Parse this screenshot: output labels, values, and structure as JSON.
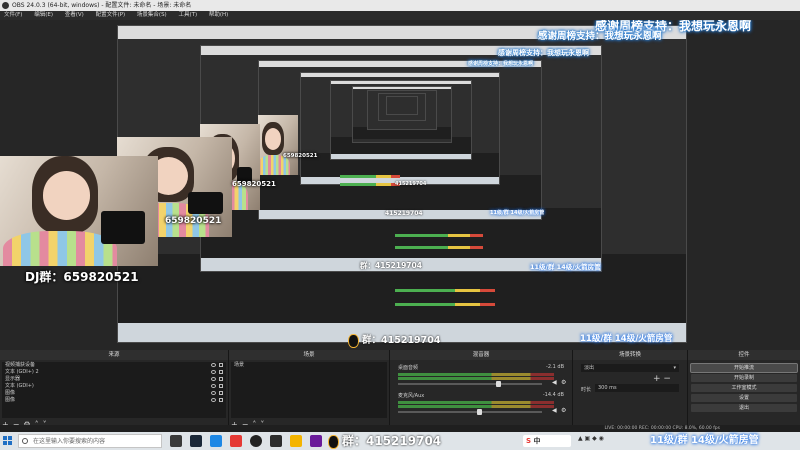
{
  "window": {
    "title": "OBS 24.0.3 (64-bit, windows) - 配置文件: 未命名 - 场景: 未命名"
  },
  "menu": [
    "文件(F)",
    "编辑(E)",
    "查看(V)",
    "配置文件(P)",
    "场景集合(S)",
    "工具(T)",
    "帮助(H)"
  ],
  "overlay": {
    "thanks_text": "感谢周榜支持：我想玩永恩啊",
    "dj_group": "DJ群：659820521",
    "dj_number": "659820521",
    "qq_group": "群：415219704",
    "qq_number": "415219704",
    "level_text": "11级/群 14级/火箭房管",
    "level_text_short": "11级/群 14级/火箭房管"
  },
  "sources": {
    "title": "来源",
    "items": [
      "视频捕获设备",
      "文本 (GDI+) 2",
      "显示器",
      "文本 (GDI+)",
      "图像",
      "图像"
    ]
  },
  "scenes": {
    "title": "场景",
    "items": [
      "场景"
    ]
  },
  "mixer": {
    "title": "混音器",
    "channels": [
      {
        "name": "桌面音频",
        "db": "-2.1 dB",
        "level": 0.68
      },
      {
        "name": "麦克风/Aux",
        "db": "-14.4 dB",
        "level": 0.55
      }
    ]
  },
  "transitions": {
    "title": "场景转换",
    "type": "淡出",
    "duration_label": "时长",
    "duration_value": "300 ms"
  },
  "controls": {
    "title": "控件",
    "buttons": [
      "开始推流",
      "开始录制",
      "工作室模式",
      "设置",
      "退出"
    ]
  },
  "status": {
    "text": "LIVE: 00:00:00   REC: 00:00:00   CPU: 8.0%, 60.00 fps"
  },
  "taskbar": {
    "search_placeholder": "在这里输入你要搜索的内容",
    "ime": "中",
    "clock": "11级/群 14级/火箭房管"
  },
  "colors": {
    "accent_blue": "#2a7fd6",
    "meter_green": "#3f8f3f",
    "meter_yellow": "#9a8a2e",
    "meter_red": "#8a2e2e"
  }
}
